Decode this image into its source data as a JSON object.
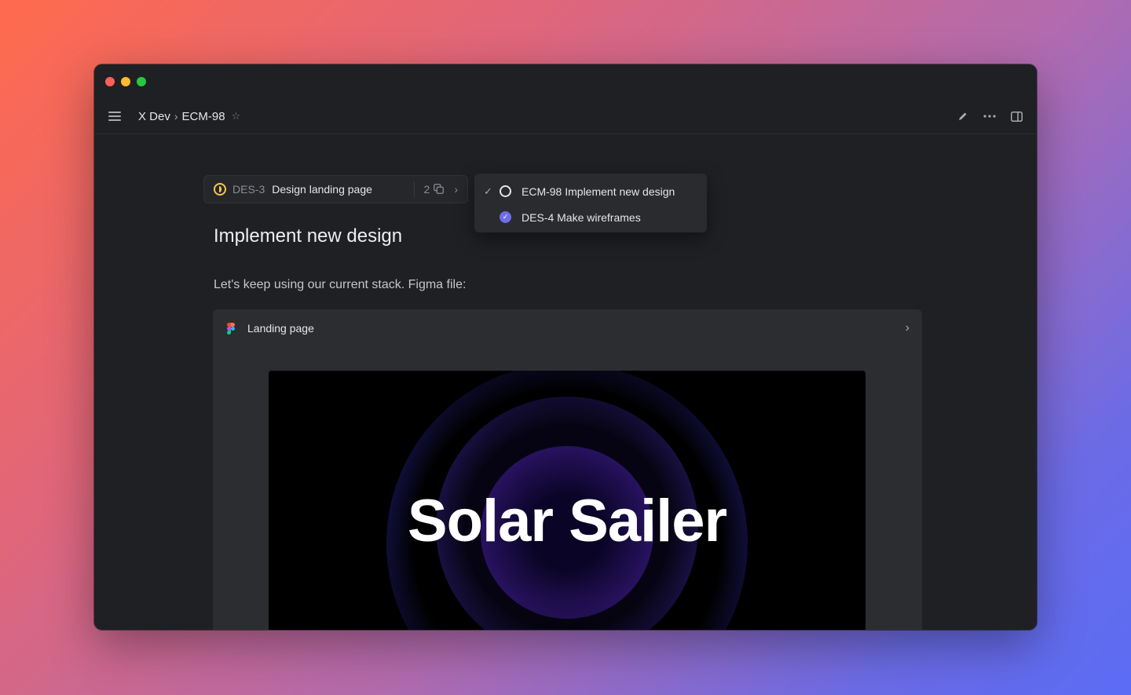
{
  "breadcrumb": {
    "team": "X Dev",
    "separator": "›",
    "issue": "ECM-98"
  },
  "parent_issue": {
    "id": "DES-3",
    "title": "Design landing page",
    "sub_issue_count": "2",
    "status_color": "#f2c94c"
  },
  "dropdown": {
    "items": [
      {
        "check": "✓",
        "label": "ECM-98 Implement new design",
        "status": "todo"
      },
      {
        "check": "",
        "label": "DES-4 Make wireframes",
        "status": "done"
      }
    ]
  },
  "issue": {
    "title": "Implement new design",
    "description": "Let's keep using our current stack. Figma file:"
  },
  "embed": {
    "title": "Landing page",
    "preview_text": "Solar Sailer"
  },
  "icons": {
    "menu": "menu-icon",
    "star": "star-icon",
    "edit": "pencil-icon",
    "more": "more-icon",
    "panel": "sidebar-toggle-icon"
  },
  "colors": {
    "accent": "#6e6ee6",
    "background": "#1f2023"
  }
}
